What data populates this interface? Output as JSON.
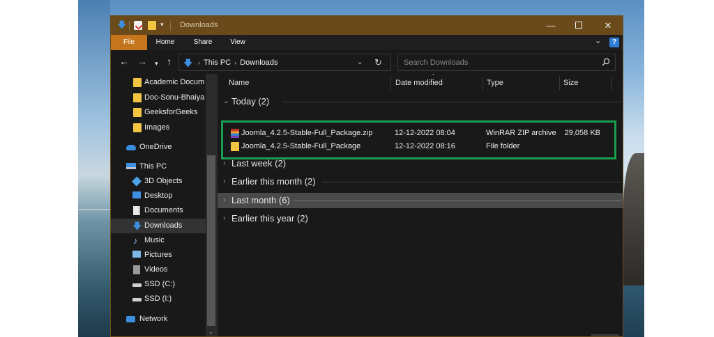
{
  "window": {
    "title": "Downloads",
    "controls": {
      "minimize": "—",
      "maximize": "",
      "close": "✕"
    }
  },
  "ribbon": {
    "tabs": [
      "File",
      "Home",
      "Share",
      "View"
    ],
    "help": "?"
  },
  "address_bar": {
    "path": [
      "This PC",
      "Downloads"
    ],
    "search_placeholder": "Search Downloads"
  },
  "nav_pane": {
    "items": [
      {
        "label": "Academic Docum",
        "icon": "folder-icon"
      },
      {
        "label": "Doc-Sonu-Bhaiya",
        "icon": "folder-icon"
      },
      {
        "label": "GeeksforGeeks",
        "icon": "folder-icon"
      },
      {
        "label": "Images",
        "icon": "folder-icon"
      },
      {
        "label": "OneDrive",
        "icon": "onedrive-icon"
      },
      {
        "label": "This PC",
        "icon": "this-pc-icon"
      },
      {
        "label": "3D Objects",
        "icon": "3d-objects-icon"
      },
      {
        "label": "Desktop",
        "icon": "desktop-icon"
      },
      {
        "label": "Documents",
        "icon": "documents-icon"
      },
      {
        "label": "Downloads",
        "icon": "downloads-icon",
        "selected": true
      },
      {
        "label": "Music",
        "icon": "music-icon"
      },
      {
        "label": "Pictures",
        "icon": "pictures-icon"
      },
      {
        "label": "Videos",
        "icon": "videos-icon"
      },
      {
        "label": "SSD (C:)",
        "icon": "drive-icon"
      },
      {
        "label": "SSD (I:)",
        "icon": "drive-icon"
      },
      {
        "label": "Network",
        "icon": "network-icon"
      }
    ]
  },
  "columns": {
    "name": "Name",
    "date": "Date modified",
    "type": "Type",
    "size": "Size"
  },
  "groups": [
    {
      "label": "Today (2)",
      "expanded": true
    },
    {
      "label": "Last week (2)"
    },
    {
      "label": "Earlier this month (2)"
    },
    {
      "label": "Last month (6)",
      "highlighted": true
    },
    {
      "label": "Earlier this year (2)"
    }
  ],
  "files": [
    {
      "name": "Joomla_4.2.5-Stable-Full_Package.zip",
      "date": "12-12-2022 08:04",
      "type": "WinRAR ZIP archive",
      "size": "29,058 KB",
      "icon": "winrar-zip-icon"
    },
    {
      "name": "Joomla_4.2.5-Stable-Full_Package",
      "date": "12-12-2022 08:16",
      "type": "File folder",
      "size": "",
      "icon": "folder-icon"
    }
  ],
  "colors": {
    "titlebar": "#6a4a1b",
    "file_tab": "#c5761c",
    "highlight_border": "#18a050",
    "accent_blue": "#3d8fe0"
  }
}
